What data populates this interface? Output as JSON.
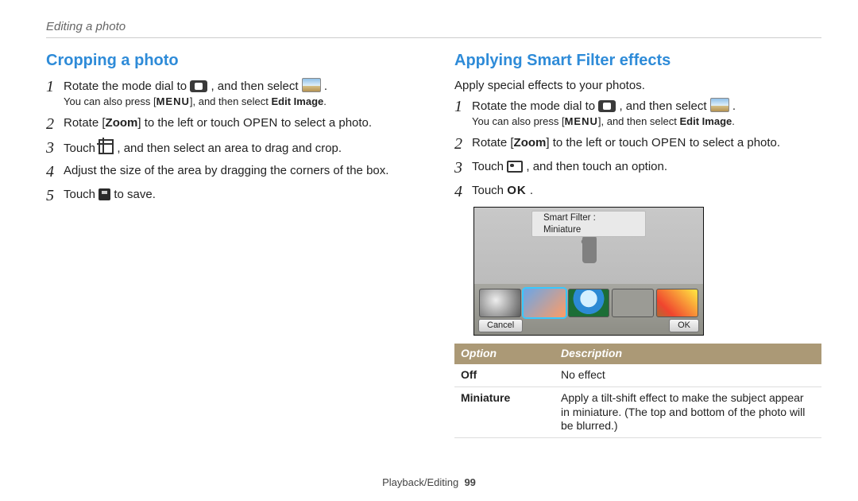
{
  "chapter_title": "Editing a photo",
  "footer": {
    "section": "Playback/Editing",
    "page": "99"
  },
  "left": {
    "heading": "Cropping a photo",
    "steps": [
      {
        "n": "1",
        "pre": "Rotate the mode dial to ",
        "post": " , and then select ",
        "tail": " .",
        "sub_pre": "You can also press [",
        "sub_menu": "MENU",
        "sub_mid": "], and then select ",
        "sub_bold": "Edit Image",
        "sub_end": "."
      },
      {
        "n": "2",
        "pre": "Rotate [",
        "zoom": "Zoom",
        "mid": "] to the left or touch ",
        "open": "OPEN",
        "post": " to select a photo."
      },
      {
        "n": "3",
        "pre": "Touch ",
        "post": " , and then select an area to drag and crop."
      },
      {
        "n": "4",
        "text": "Adjust the size of the area by dragging the corners of the box."
      },
      {
        "n": "5",
        "pre": "Touch ",
        "post": " to save."
      }
    ]
  },
  "right": {
    "heading": "Applying Smart Filter effects",
    "intro": "Apply special effects to your photos.",
    "steps": [
      {
        "n": "1",
        "pre": "Rotate the mode dial to ",
        "post": " , and then select ",
        "tail": " .",
        "sub_pre": "You can also press [",
        "sub_menu": "MENU",
        "sub_mid": "], and then select ",
        "sub_bold": "Edit Image",
        "sub_end": "."
      },
      {
        "n": "2",
        "pre": "Rotate [",
        "zoom": "Zoom",
        "mid": "] to the left or touch ",
        "open": "OPEN",
        "post": " to select a photo."
      },
      {
        "n": "3",
        "pre": "Touch ",
        "post": " , and then touch an option."
      },
      {
        "n": "4",
        "pre": "Touch ",
        "ok": "OK",
        "post": " ."
      }
    ],
    "preview": {
      "label": "Smart Filter : Miniature",
      "cancel": "Cancel",
      "ok": "OK"
    },
    "table": {
      "head_option": "Option",
      "head_desc": "Description",
      "rows": [
        {
          "opt": "Off",
          "desc": "No effect"
        },
        {
          "opt": "Miniature",
          "desc": "Apply a tilt-shift effect to make the subject appear in miniature. (The top and bottom of the photo will be blurred.)"
        }
      ]
    }
  }
}
